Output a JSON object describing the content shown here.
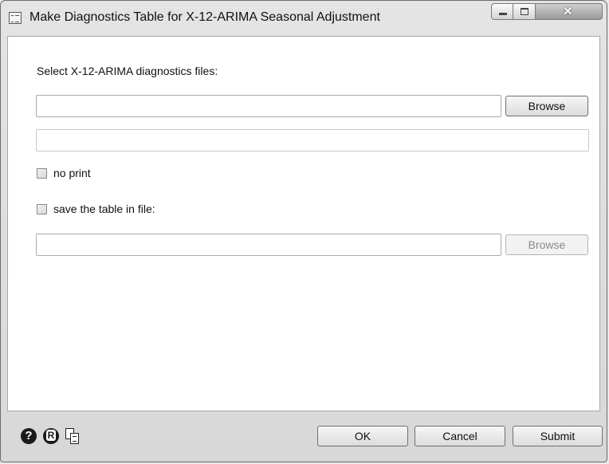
{
  "window": {
    "title": "Make Diagnostics Table for X-12-ARIMA Seasonal Adjustment"
  },
  "form": {
    "select_label": "Select X-12-ARIMA diagnostics files:",
    "files_value": "",
    "browse_label": "Browse",
    "secondary_value": "",
    "no_print_label": "no print",
    "no_print_checked": false,
    "save_label": "save the table in file:",
    "save_checked": false,
    "save_path_value": "",
    "save_browse_label": "Browse"
  },
  "footer": {
    "icons": [
      "help-icon",
      "r-icon",
      "copy-icon"
    ],
    "ok_label": "OK",
    "cancel_label": "Cancel",
    "submit_label": "Submit"
  }
}
